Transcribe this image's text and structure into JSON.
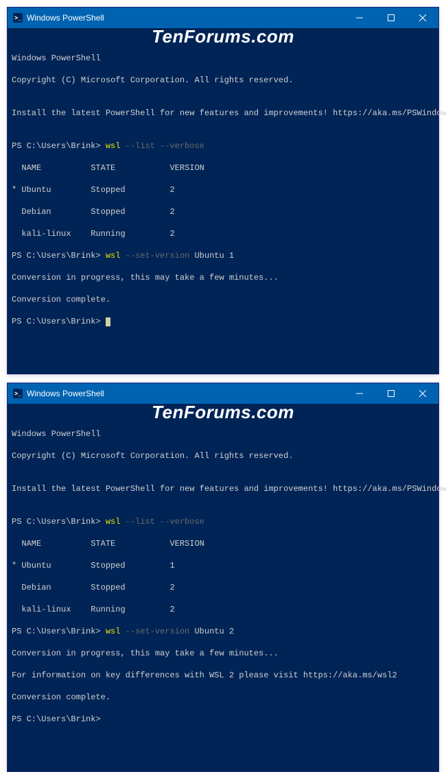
{
  "watermark": "TenForums.com",
  "windows": [
    {
      "title": "Windows PowerShell",
      "header_lines": [
        "Windows PowerShell",
        "Copyright (C) Microsoft Corporation. All rights reserved.",
        "",
        "Install the latest PowerShell for new features and improvements! https://aka.ms/PSWindows",
        ""
      ],
      "prompt": "PS C:\\Users\\Brink>",
      "cmd1_exec": "wsl",
      "cmd1_args": "--list --verbose",
      "list_header": {
        "name": "  NAME",
        "state": "STATE",
        "version": "VERSION"
      },
      "list_rows": [
        {
          "name": "* Ubuntu",
          "state": "Stopped",
          "version": "2"
        },
        {
          "name": "  Debian",
          "state": "Stopped",
          "version": "2"
        },
        {
          "name": "  kali-linux",
          "state": "Running",
          "version": "2"
        }
      ],
      "cmd2_exec": "wsl",
      "cmd2_args_gray": "--set-version",
      "cmd2_args_rest": "Ubuntu 1",
      "output_lines": [
        "Conversion in progress, this may take a few minutes...",
        "Conversion complete."
      ]
    },
    {
      "title": "Windows PowerShell",
      "header_lines": [
        "Windows PowerShell",
        "Copyright (C) Microsoft Corporation. All rights reserved.",
        "",
        "Install the latest PowerShell for new features and improvements! https://aka.ms/PSWindows",
        ""
      ],
      "prompt": "PS C:\\Users\\Brink>",
      "cmd1_exec": "wsl",
      "cmd1_args": "--list --verbose",
      "list_header": {
        "name": "  NAME",
        "state": "STATE",
        "version": "VERSION"
      },
      "list_rows": [
        {
          "name": "* Ubuntu",
          "state": "Stopped",
          "version": "1"
        },
        {
          "name": "  Debian",
          "state": "Stopped",
          "version": "2"
        },
        {
          "name": "  kali-linux",
          "state": "Running",
          "version": "2"
        }
      ],
      "cmd2_exec": "wsl",
      "cmd2_args_gray": "--set-version",
      "cmd2_args_rest": "Ubuntu 2",
      "output_lines": [
        "Conversion in progress, this may take a few minutes...",
        "For information on key differences with WSL 2 please visit https://aka.ms/wsl2",
        "Conversion complete."
      ]
    }
  ]
}
